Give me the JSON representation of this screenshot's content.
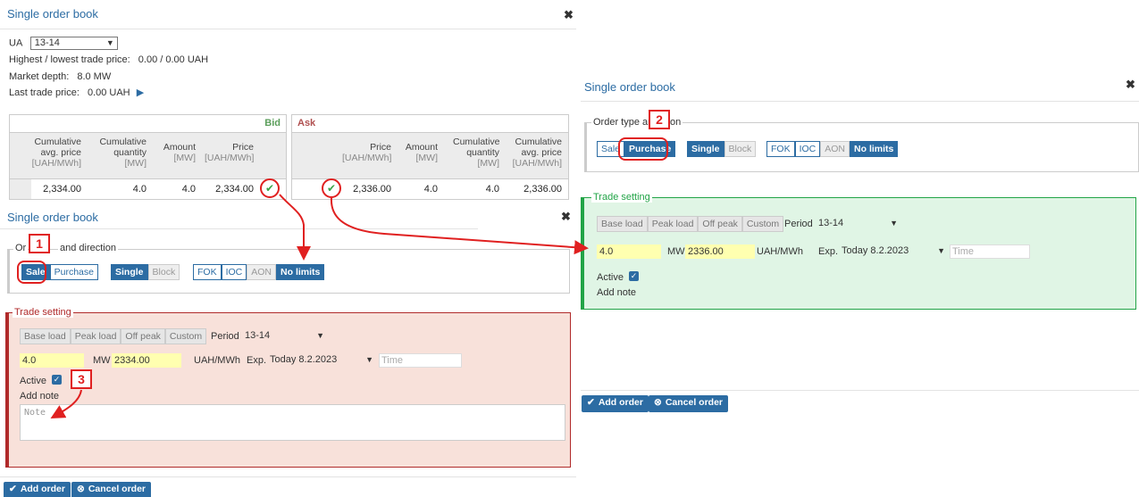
{
  "left": {
    "title": "Single order book",
    "close": "✖",
    "market_label": "UA",
    "market_value": "13-14",
    "high_low_label": "Highest / lowest trade price:",
    "high_low_value": "0.00 / 0.00 UAH",
    "depth_label": "Market depth:",
    "depth_value": "8.0 MW",
    "last_label": "Last trade price:",
    "last_value": "0.00 UAH",
    "bid": {
      "header": "Bid",
      "columns": [
        {
          "l1": "Cumulative",
          "l2": "avg. price",
          "unit": "[UAH/MWh]"
        },
        {
          "l1": "Cumulative",
          "l2": "quantity",
          "unit": "[MW]"
        },
        {
          "l1": "Amount",
          "l2": "",
          "unit": "[MW]"
        },
        {
          "l1": "Price",
          "l2": "",
          "unit": "[UAH/MWh]"
        }
      ],
      "row": [
        "2,334.00",
        "4.0",
        "4.0",
        "2,334.00"
      ]
    },
    "ask": {
      "header": "Ask",
      "columns": [
        {
          "l1": "Price",
          "l2": "",
          "unit": "[UAH/MWh]"
        },
        {
          "l1": "Amount",
          "l2": "",
          "unit": "[MW]"
        },
        {
          "l1": "Cumulative",
          "l2": "quantity",
          "unit": "[MW]"
        },
        {
          "l1": "Cumulative",
          "l2": "avg. price",
          "unit": "[UAH/MWh]"
        }
      ],
      "row": [
        "2,336.00",
        "4.0",
        "4.0",
        "2,336.00"
      ]
    }
  },
  "sale_form": {
    "title": "Single order book",
    "close": "✖",
    "legend_a": "Or",
    "legend_b": "and direction",
    "direction": [
      "Sale",
      "Purchase"
    ],
    "type": [
      "Single",
      "Block"
    ],
    "cond": [
      "FOK",
      "IOC",
      "AON",
      "No limits"
    ],
    "trade_legend": "Trade setting",
    "load": [
      "Base load",
      "Peak load",
      "Off peak",
      "Custom"
    ],
    "period_label": "Period",
    "period_value": "13-14",
    "qty": "4.0",
    "qty_unit": "MW",
    "price": "2334.00",
    "price_unit": "UAH/MWh",
    "exp_label": "Exp.",
    "exp_value": "Today 8.2.2023",
    "time_placeholder": "Time",
    "active_label": "Active",
    "note_label": "Add note",
    "note_placeholder": "Note",
    "add": "Add order",
    "cancel": "Cancel order"
  },
  "purchase_form": {
    "title": "Single order book",
    "close": "✖",
    "legend_a": "Order type an",
    "legend_b": "on",
    "direction": [
      "Sale",
      "Purchase"
    ],
    "type": [
      "Single",
      "Block"
    ],
    "cond": [
      "FOK",
      "IOC",
      "AON",
      "No limits"
    ],
    "trade_legend": "Trade setting",
    "load": [
      "Base load",
      "Peak load",
      "Off peak",
      "Custom"
    ],
    "period_label": "Period",
    "period_value": "13-14",
    "qty": "4.0",
    "qty_unit": "MW",
    "price": "2336.00",
    "price_unit": "UAH/MWh",
    "exp_label": "Exp.",
    "exp_value": "Today 8.2.2023",
    "time_placeholder": "Time",
    "active_label": "Active",
    "note_label": "Add note",
    "add": "Add order",
    "cancel": "Cancel order"
  },
  "annotations": {
    "b1": "1",
    "b2": "2",
    "b3": "3"
  },
  "icons": {
    "close": "close-icon",
    "check": "check-icon",
    "arrow": "triangle-right-icon",
    "cancel": "x-circle-icon"
  },
  "colors": {
    "accent": "#2c6ca3",
    "highlight": "#e02020",
    "sale_bg": "#f8e1da",
    "purchase_bg": "#e0f5e5",
    "sale_bar": "#b02a2a",
    "purchase_bar": "#22a447",
    "field": "#ffffb0"
  }
}
